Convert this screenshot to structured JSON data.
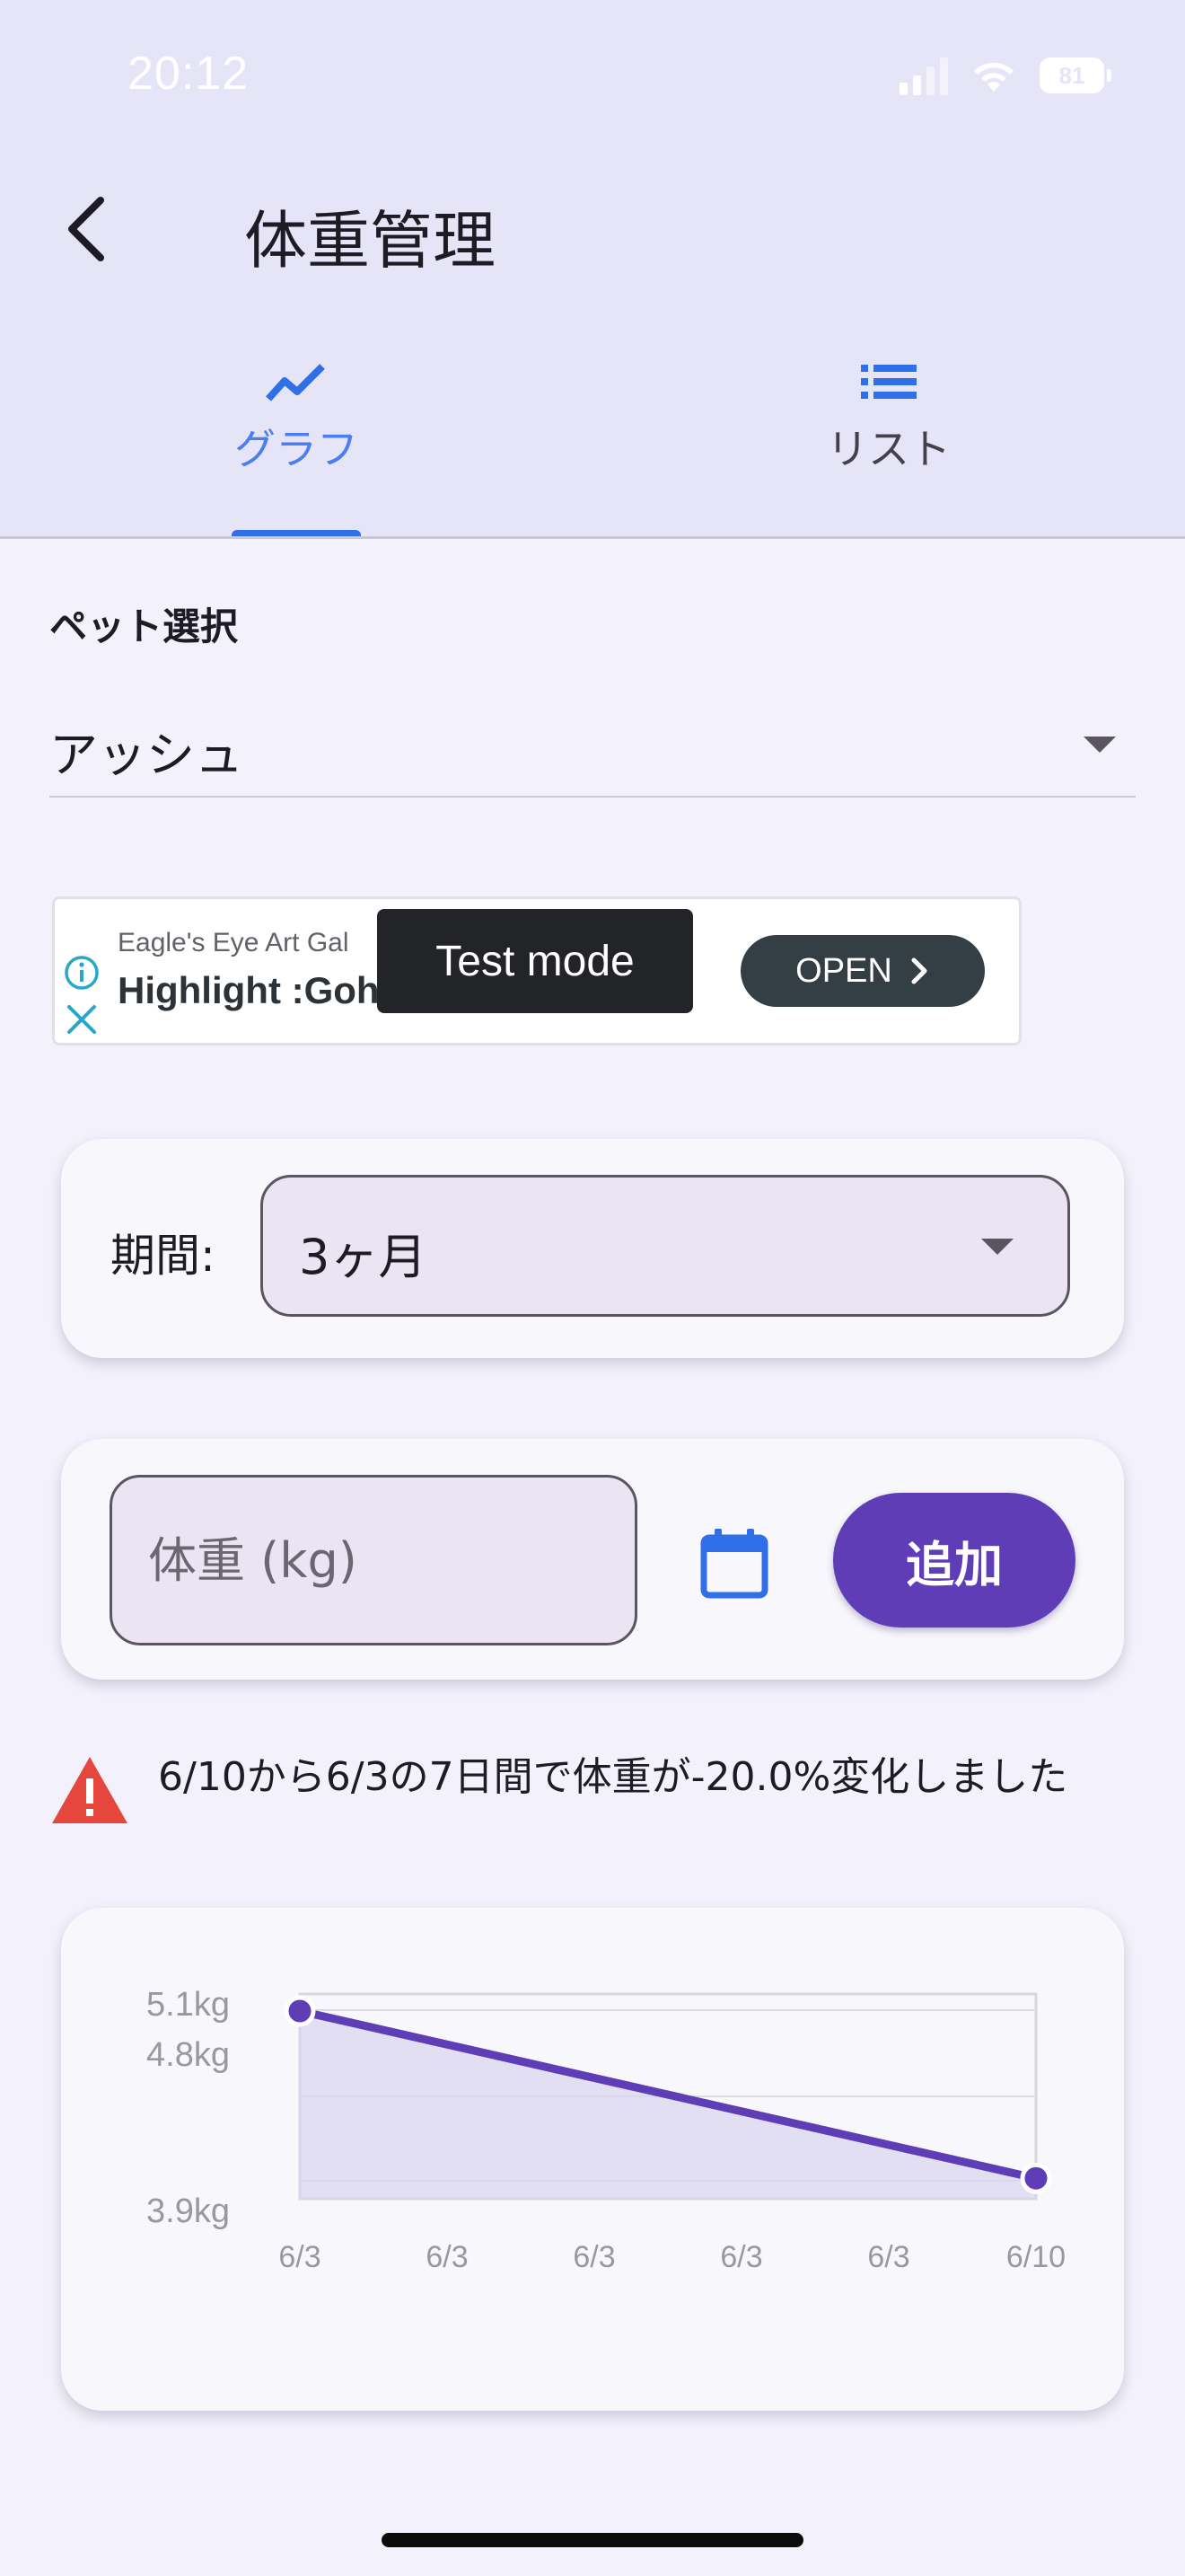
{
  "status_bar": {
    "time": "20:12",
    "battery": "81"
  },
  "header": {
    "title": "体重管理",
    "back_icon": "back-arrow-icon"
  },
  "tabs": [
    {
      "label": "グラフ",
      "icon": "trend-line-icon",
      "selected": true
    },
    {
      "label": "リスト",
      "icon": "list-icon",
      "selected": false
    }
  ],
  "pet": {
    "section_label": "ペット選択",
    "selected": "アッシュ"
  },
  "ad": {
    "subtitle": "Eagle's Eye Art Gal",
    "headline": "Highlight :Goh",
    "test_mode": "Test mode",
    "open_label": "OPEN"
  },
  "period": {
    "label": "期間:",
    "selected": "3ヶ月"
  },
  "weight_entry": {
    "placeholder": "体重 (kg)",
    "add_label": "追加"
  },
  "alert": {
    "message": "6/10から6/3の7日間で体重が-20.0%変化しました"
  },
  "colors": {
    "accent": "#5f3db6",
    "tab_active": "#4c7ef3",
    "alert": "#e5473d"
  },
  "chart_data": {
    "type": "area",
    "x_tick_labels": [
      "6/3",
      "6/3",
      "6/3",
      "6/3",
      "6/3",
      "6/10"
    ],
    "y_tick_labels": [
      "5.1kg",
      "4.8kg",
      "3.9kg"
    ],
    "points": [
      {
        "x": "6/3",
        "y": 4.9
      },
      {
        "x": "6/10",
        "y": 3.92
      }
    ],
    "ylim": [
      3.8,
      5.0
    ],
    "grid": true
  }
}
